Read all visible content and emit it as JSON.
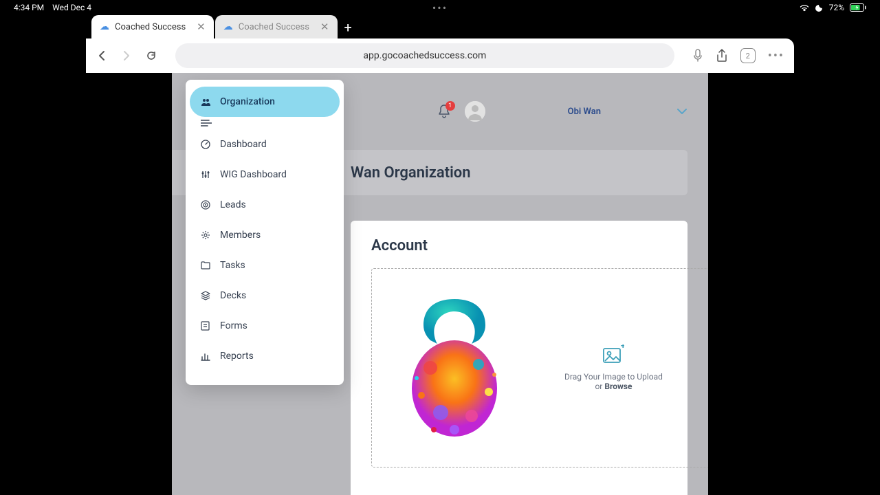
{
  "status": {
    "time": "4:34 PM",
    "date": "Wed Dec 4",
    "battery": "72%"
  },
  "browser": {
    "tabs": [
      {
        "label": "Coached Success",
        "active": true
      },
      {
        "label": "Coached Success",
        "active": false
      }
    ],
    "url": "app.gocoachedsuccess.com",
    "tab_count": "2"
  },
  "header": {
    "notification_count": "1",
    "username": "Obi Wan"
  },
  "page": {
    "title": "Wan Organization",
    "section_title": "Account"
  },
  "upload": {
    "line1": "Drag Your Image to Upload",
    "line2_prefix": "or ",
    "line2_action": "Browse"
  },
  "sidebar": {
    "items": [
      {
        "label": "Organization",
        "icon": "users"
      },
      {
        "label": "Dashboard",
        "icon": "gauge"
      },
      {
        "label": "WIG Dashboard",
        "icon": "sliders"
      },
      {
        "label": "Leads",
        "icon": "target"
      },
      {
        "label": "Members",
        "icon": "gear"
      },
      {
        "label": "Tasks",
        "icon": "folder"
      },
      {
        "label": "Decks",
        "icon": "layers"
      },
      {
        "label": "Forms",
        "icon": "form"
      },
      {
        "label": "Reports",
        "icon": "barchart"
      }
    ]
  }
}
